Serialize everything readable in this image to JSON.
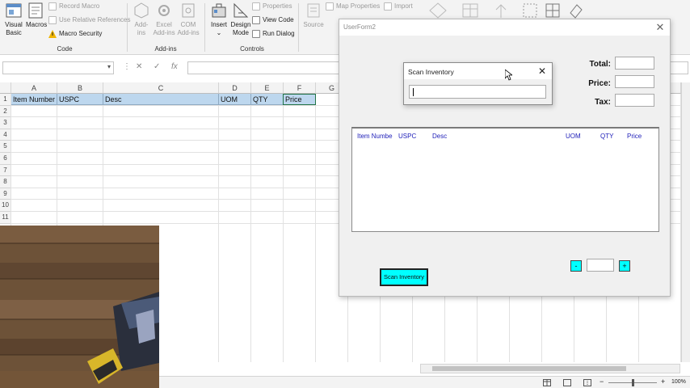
{
  "ribbon": {
    "code": {
      "group_label": "Code",
      "visual_basic_l1": "Visual",
      "visual_basic_l2": "Basic",
      "macros": "Macros",
      "record_macro": "Record Macro",
      "use_relative": "Use Relative References",
      "macro_security": "Macro Security"
    },
    "addins": {
      "group_label": "Add-ins",
      "addins_l1": "Add-",
      "addins_l2": "ins",
      "excel_addins_l1": "Excel",
      "excel_addins_l2": "Add-ins",
      "com_addins_l1": "COM",
      "com_addins_l2": "Add-ins"
    },
    "controls": {
      "group_label": "Controls",
      "insert_l1": "Insert",
      "insert_l2": "⌄",
      "design_mode_l1": "Design",
      "design_mode_l2": "Mode",
      "properties": "Properties",
      "view_code": "View Code",
      "run_dialog": "Run Dialog"
    },
    "xml": {
      "source": "Source",
      "map_properties": "Map Properties",
      "import": "Import"
    }
  },
  "formula_bar": {
    "name_box": "",
    "fx": "fx",
    "cancel": "✕",
    "enter": "✓",
    "formula": ""
  },
  "sheet": {
    "columns": [
      "A",
      "B",
      "C",
      "D",
      "E",
      "F",
      "G"
    ],
    "rows": [
      "1",
      "2",
      "3",
      "4",
      "5",
      "6",
      "7",
      "8",
      "9",
      "10",
      "11"
    ],
    "header_row": [
      "Item Number",
      "USPC",
      "Desc",
      "UOM",
      "QTY",
      "Price"
    ]
  },
  "userform": {
    "title": "UserForm2",
    "total_label": "Total:",
    "price_label": "Price:",
    "tax_label": "Tax:",
    "total_value": "",
    "price_value": "",
    "tax_value": "",
    "list_headers": [
      "Item Numbe",
      "USPC",
      "Desc",
      "UOM",
      "QTY",
      "Price"
    ],
    "scan_button": "Scan Inventory",
    "minus": "-",
    "plus": "+",
    "qty_value": ""
  },
  "scan_dialog": {
    "title": "Scan Inventory",
    "input_value": ""
  },
  "status_bar": {
    "zoom": "100%"
  },
  "colors": {
    "accent_button": "#00ffff",
    "header_fill": "#bdd7ee",
    "list_header_text": "#1d1db8"
  }
}
